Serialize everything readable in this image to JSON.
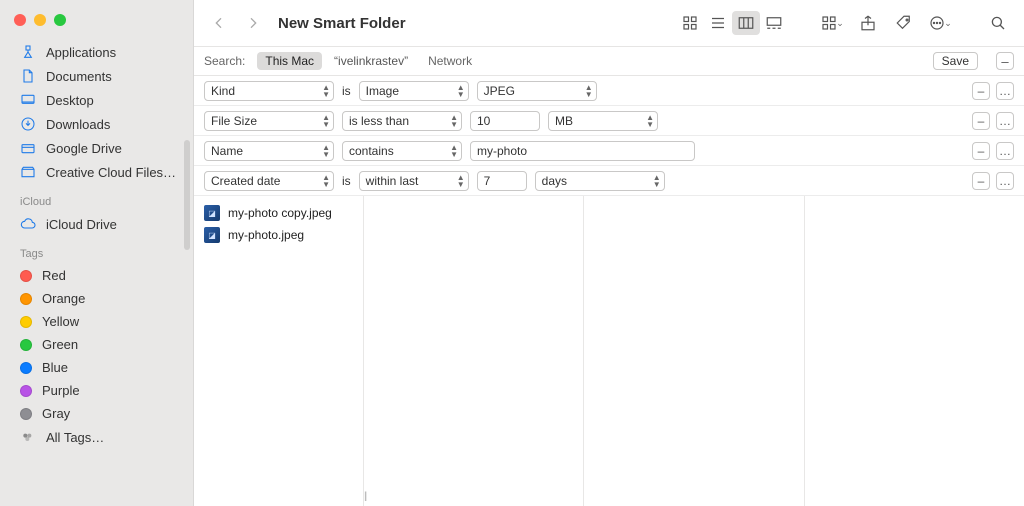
{
  "window": {
    "title": "New Smart Folder"
  },
  "sidebar": {
    "favorites": [
      {
        "label": "Applications",
        "icon": "applications"
      },
      {
        "label": "Documents",
        "icon": "documents"
      },
      {
        "label": "Desktop",
        "icon": "desktop"
      },
      {
        "label": "Downloads",
        "icon": "downloads"
      },
      {
        "label": "Google Drive",
        "icon": "gdrive"
      },
      {
        "label": "Creative Cloud Files…",
        "icon": "ccloud"
      }
    ],
    "icloud_section": "iCloud",
    "icloud": [
      {
        "label": "iCloud Drive"
      }
    ],
    "tags_section": "Tags",
    "tags": [
      {
        "label": "Red",
        "color": "#ff5b50"
      },
      {
        "label": "Orange",
        "color": "#ff9500"
      },
      {
        "label": "Yellow",
        "color": "#ffcc00"
      },
      {
        "label": "Green",
        "color": "#28c840"
      },
      {
        "label": "Blue",
        "color": "#0a7cff"
      },
      {
        "label": "Purple",
        "color": "#b853e6"
      },
      {
        "label": "Gray",
        "color": "#8e8e93"
      }
    ],
    "all_tags": "All Tags…"
  },
  "search": {
    "label": "Search:",
    "scopes": [
      {
        "label": "This Mac",
        "active": true
      },
      {
        "label": "“ivelinkrastev”",
        "active": false
      },
      {
        "label": "Network",
        "active": false
      }
    ],
    "save": "Save",
    "minus": "–"
  },
  "rules": [
    {
      "attr": "Kind",
      "attr_w": 130,
      "mid_static": "is",
      "op": "Image",
      "op_w": 110,
      "val_select": "JPEG",
      "val_w": 120
    },
    {
      "attr": "File Size",
      "attr_w": 130,
      "op": "is less than",
      "op_w": 120,
      "val_input": "10",
      "in_w": 70,
      "unit": "MB",
      "unit_w": 110
    },
    {
      "attr": "Name",
      "attr_w": 130,
      "op": "contains",
      "op_w": 120,
      "val_input": "my-photo",
      "in_w": 225
    },
    {
      "attr": "Created date",
      "attr_w": 130,
      "mid_static": "is",
      "op": "within last",
      "op_w": 110,
      "val_input": "7",
      "in_w": 50,
      "unit": "days",
      "unit_w": 130
    }
  ],
  "row_buttons": {
    "remove": "–",
    "more": "…"
  },
  "results": [
    {
      "name": "my-photo copy.jpeg"
    },
    {
      "name": "my-photo.jpeg"
    }
  ]
}
